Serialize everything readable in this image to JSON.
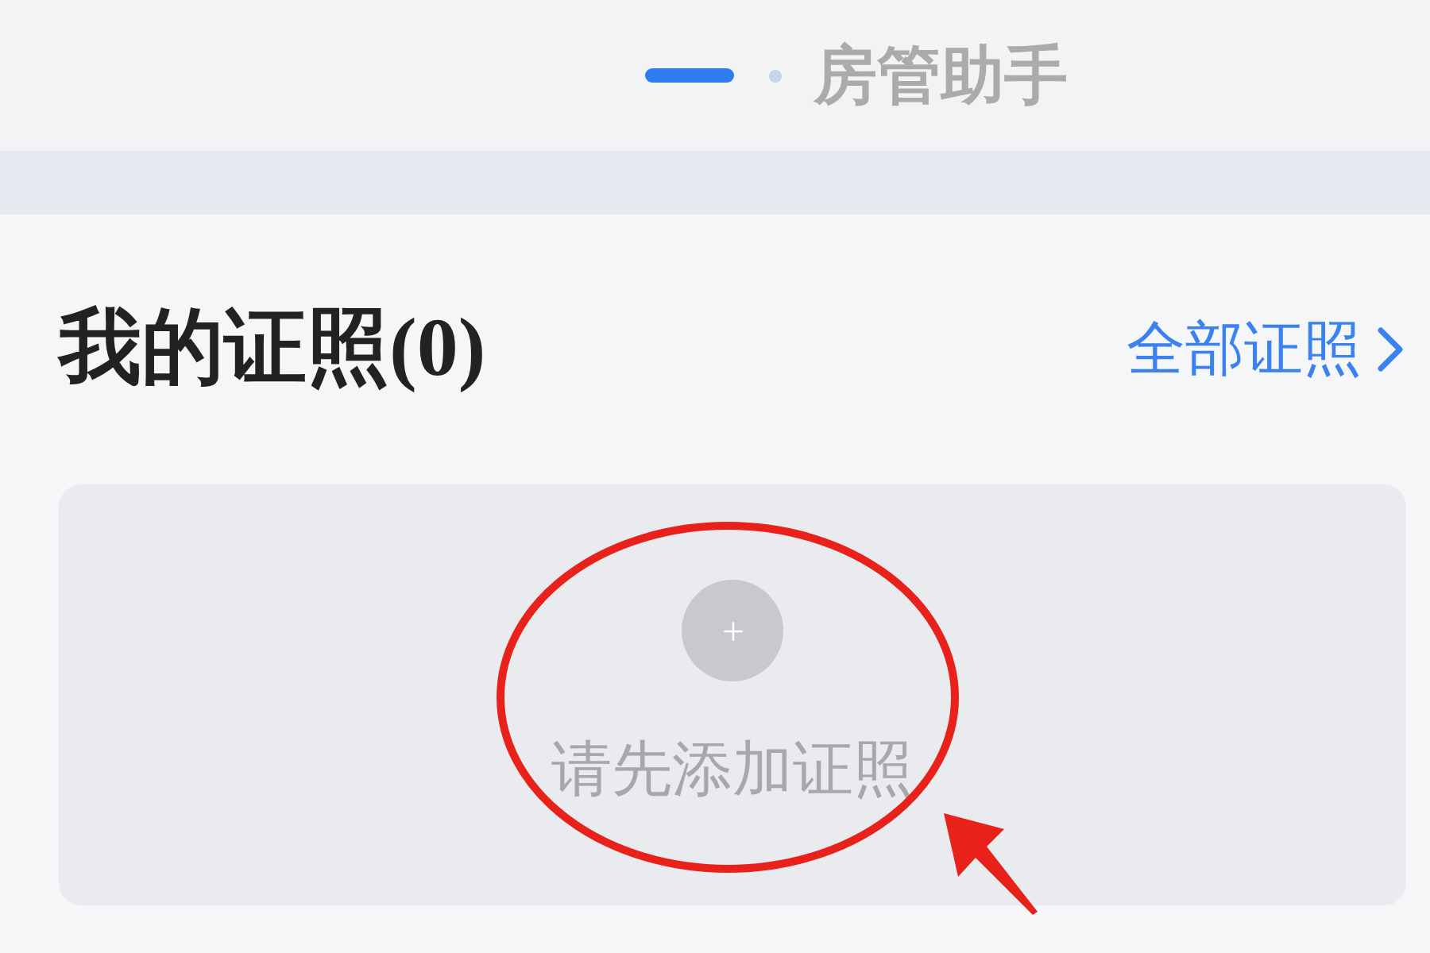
{
  "header": {
    "page_indicators": [
      {
        "selected": true
      },
      {
        "selected": false
      }
    ],
    "title": "房管助手"
  },
  "certificates": {
    "title": "我的证照(0)",
    "link": {
      "label": "全部证照"
    },
    "empty_state": {
      "message": "请先添加证照"
    }
  },
  "annotations": {
    "ellipse": true,
    "arrow": true
  }
}
